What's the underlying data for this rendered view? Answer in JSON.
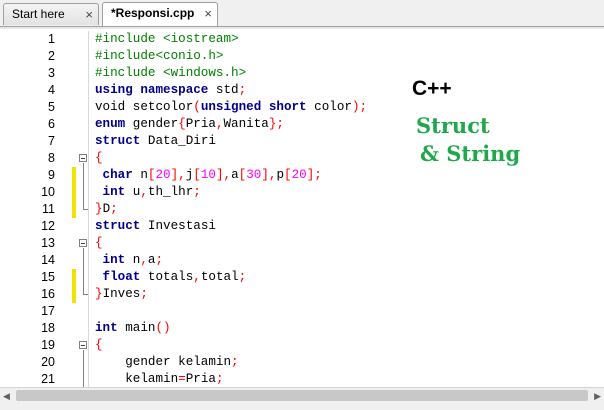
{
  "tabs": [
    {
      "label": "Start here",
      "close": "×"
    },
    {
      "label": "*Responsi.cpp",
      "close": "×"
    }
  ],
  "overlay": {
    "line1": "C++",
    "line2": "Struct",
    "line3": "& String"
  },
  "scrollbar": {
    "left": "◀",
    "right": "▶"
  },
  "code_lines": [
    {
      "n": "1",
      "t": [
        [
          "pp",
          "#include <iostream>"
        ]
      ]
    },
    {
      "n": "2",
      "t": [
        [
          "pp",
          "#include<conio.h>"
        ]
      ]
    },
    {
      "n": "3",
      "t": [
        [
          "pp",
          "#include <windows.h>"
        ]
      ]
    },
    {
      "n": "4",
      "t": [
        [
          "kw",
          "using namespace"
        ],
        [
          "",
          " std"
        ],
        [
          "op",
          ";"
        ]
      ]
    },
    {
      "n": "5",
      "t": [
        [
          "",
          "void setcolor"
        ],
        [
          "op",
          "("
        ],
        [
          "kw",
          "unsigned short"
        ],
        [
          "",
          " color"
        ],
        [
          "op",
          ");"
        ]
      ]
    },
    {
      "n": "6",
      "t": [
        [
          "kw",
          "enum"
        ],
        [
          "",
          " gender"
        ],
        [
          "op",
          "{"
        ],
        [
          "",
          "Pria"
        ],
        [
          "op",
          ","
        ],
        [
          "",
          "Wanita"
        ],
        [
          "op",
          "};"
        ]
      ]
    },
    {
      "n": "7",
      "t": [
        [
          "kw",
          "struct"
        ],
        [
          "",
          " Data_Diri"
        ]
      ]
    },
    {
      "n": "8",
      "t": [
        [
          "op",
          "{"
        ]
      ]
    },
    {
      "n": "9",
      "t": [
        [
          "kw",
          " char"
        ],
        [
          "",
          " n"
        ],
        [
          "op",
          "["
        ],
        [
          "num",
          "20"
        ],
        [
          "op",
          "],"
        ],
        [
          "",
          "j"
        ],
        [
          "op",
          "["
        ],
        [
          "num",
          "10"
        ],
        [
          "op",
          "],"
        ],
        [
          "",
          "a"
        ],
        [
          "op",
          "["
        ],
        [
          "num",
          "30"
        ],
        [
          "op",
          "],"
        ],
        [
          "",
          "p"
        ],
        [
          "op",
          "["
        ],
        [
          "num",
          "20"
        ],
        [
          "op",
          "];"
        ]
      ]
    },
    {
      "n": "10",
      "t": [
        [
          "kw",
          " int"
        ],
        [
          "",
          " u"
        ],
        [
          "op",
          ","
        ],
        [
          "",
          "th_lhr"
        ],
        [
          "op",
          ";"
        ]
      ]
    },
    {
      "n": "11",
      "t": [
        [
          "op",
          "}"
        ],
        [
          "",
          "D"
        ],
        [
          "op",
          ";"
        ]
      ]
    },
    {
      "n": "12",
      "t": [
        [
          "kw",
          "struct"
        ],
        [
          "",
          " Investasi"
        ]
      ]
    },
    {
      "n": "13",
      "t": [
        [
          "op",
          "{"
        ]
      ]
    },
    {
      "n": "14",
      "t": [
        [
          "kw",
          " int"
        ],
        [
          "",
          " n"
        ],
        [
          "op",
          ","
        ],
        [
          "",
          "a"
        ],
        [
          "op",
          ";"
        ]
      ]
    },
    {
      "n": "15",
      "t": [
        [
          "kw",
          " float"
        ],
        [
          "",
          " totals"
        ],
        [
          "op",
          ","
        ],
        [
          "",
          "total"
        ],
        [
          "op",
          ";"
        ]
      ]
    },
    {
      "n": "16",
      "t": [
        [
          "op",
          "}"
        ],
        [
          "",
          "Inves"
        ],
        [
          "op",
          ";"
        ]
      ]
    },
    {
      "n": "17",
      "t": []
    },
    {
      "n": "18",
      "t": [
        [
          "kw",
          "int"
        ],
        [
          "",
          " main"
        ],
        [
          "op",
          "()"
        ]
      ]
    },
    {
      "n": "19",
      "t": [
        [
          "op",
          "{"
        ]
      ]
    },
    {
      "n": "20",
      "t": [
        [
          "",
          "    gender kelamin"
        ],
        [
          "op",
          ";"
        ]
      ]
    },
    {
      "n": "21",
      "t": [
        [
          "",
          "    kelamin"
        ],
        [
          "op",
          "="
        ],
        [
          "",
          "Pria"
        ],
        [
          "op",
          ";"
        ]
      ]
    }
  ]
}
